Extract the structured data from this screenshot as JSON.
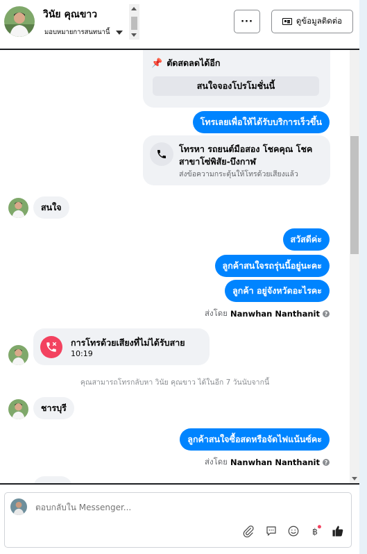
{
  "header": {
    "contact_name": "วินัย คุณขาว",
    "assign_label": "มอบหมายการสนทนานี้",
    "more_label": "···",
    "contact_info_label": "ดูข้อมูลติดต่อ"
  },
  "messages": {
    "promo_cut": "ตัดสดลดได้อีก",
    "book_promo": "สนใจจองโปรโมชั่นนี้",
    "call_cta": "โทรเลยเพื่อให้ได้รับบริการเร็วขึ้น",
    "call_title": "โทรหา รถยนต์มือสอง โชคคุณ โชค สาขาโซ่พิสัย-บึงกาฬ",
    "call_sub": "ส่งข้อความกระตุ้นให้โทรด้วยเสียงแล้ว",
    "in_1": "สนใจ",
    "out_1": "สวัสดีค่ะ",
    "out_2": "ลูกค้าสนใจรถรุ่นนี้อยู่นะคะ",
    "out_3": "ลูกค้า อยู่จังหวัดอะไรคะ",
    "sent_by_1_prefix": "ส่งโดย",
    "sent_by_1_name": "Nanwhan Nanthanit",
    "missed_title": "การโทรด้วยเสียงที่ไม่ได้รับสาย",
    "missed_time": "10:19",
    "callback_notice": "คุณสามารถโทรกลับหา วินัย คุณขาว ได้ในอีก 7 วันนับจากนี้",
    "in_2": "ชารบุรี",
    "out_4": "ลูกค้าสนใจซื้อสดหรือจัดไฟแน้นซ์คะ",
    "sent_by_2_prefix": "ส่งโดย",
    "sent_by_2_name": "Nanwhan Nanthanit"
  },
  "composer": {
    "placeholder": "ตอบกลับใน Messenger..."
  },
  "colors": {
    "brand_blue": "#0084ff",
    "missed_red": "#f3425f",
    "bubble_gray": "#f0f2f5"
  }
}
